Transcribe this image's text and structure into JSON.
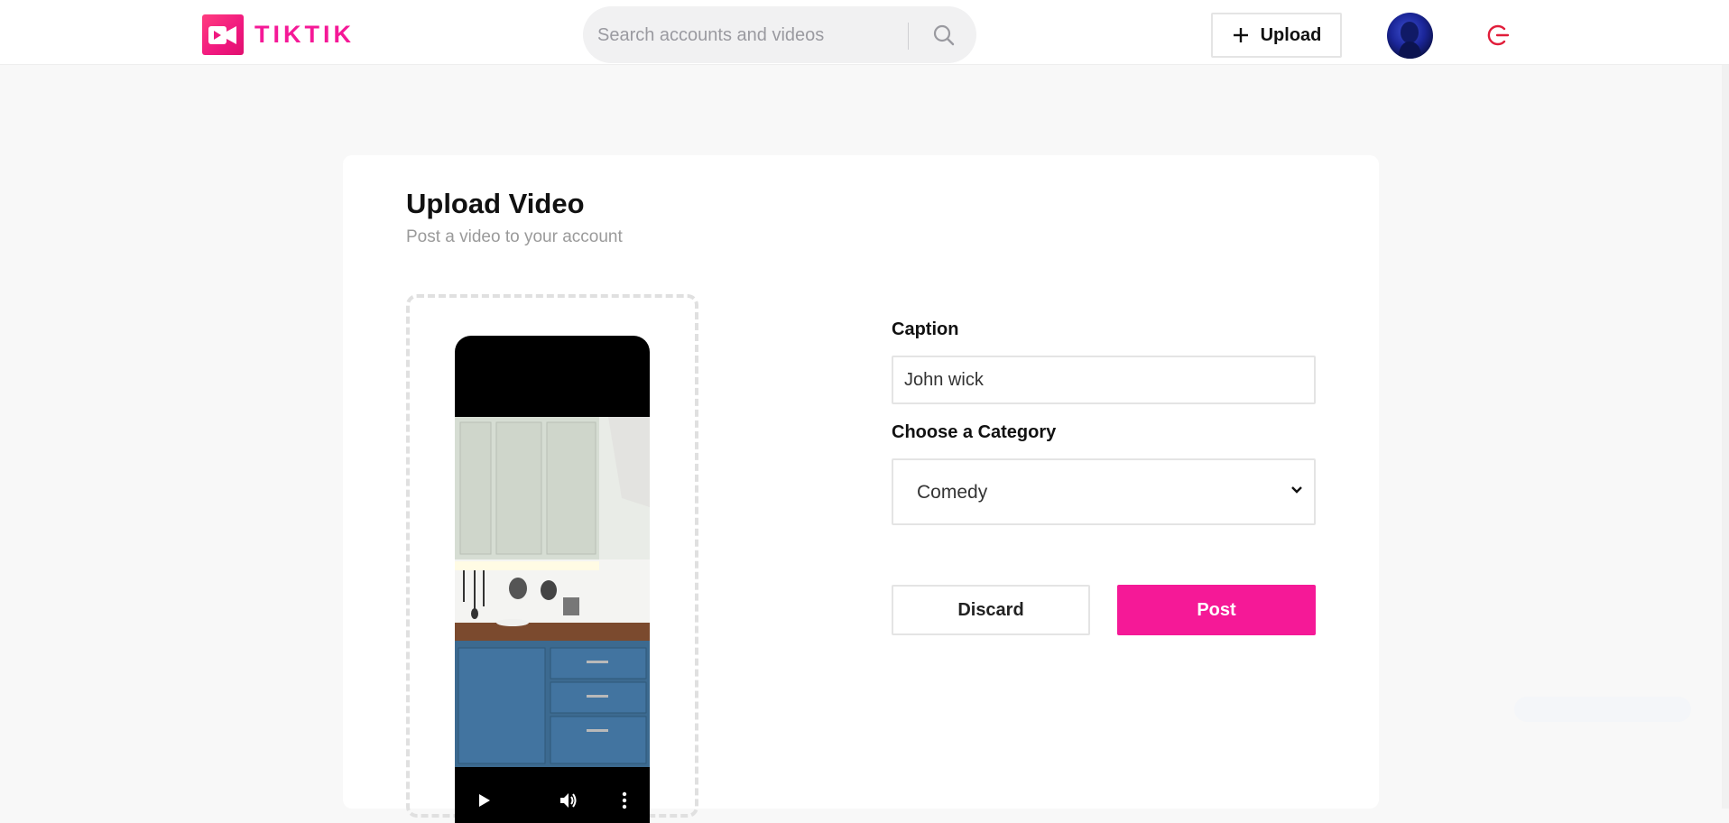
{
  "header": {
    "logo_text": "TIKTIK",
    "search_placeholder": "Search accounts and videos",
    "upload_label": "Upload",
    "icons": {
      "search": "search-icon",
      "plus": "plus-icon",
      "logout": "logout-icon"
    },
    "colors": {
      "brand": "#f51997",
      "logout": "#e11d3a"
    }
  },
  "upload_page": {
    "title": "Upload Video",
    "subtitle": "Post a video to your account",
    "form": {
      "caption_label": "Caption",
      "caption_value": "John wick",
      "category_label": "Choose a Category",
      "category_value": "Comedy",
      "discard_label": "Discard",
      "post_label": "Post"
    },
    "video_controls": [
      "play-icon",
      "volume-icon",
      "more-vertical-icon"
    ]
  }
}
